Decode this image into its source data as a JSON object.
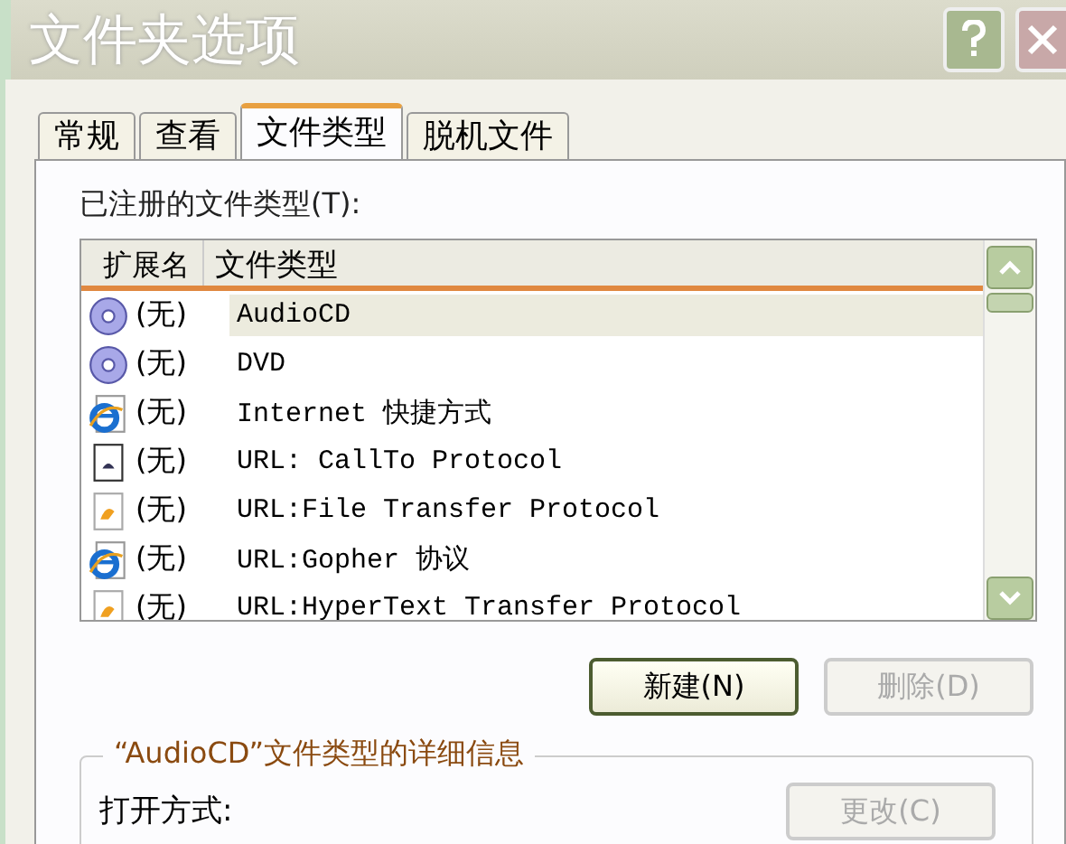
{
  "window": {
    "title": "文件夹选项"
  },
  "tabs": [
    {
      "label": "常规",
      "selected": false
    },
    {
      "label": "查看",
      "selected": false
    },
    {
      "label": "文件类型",
      "selected": true
    },
    {
      "label": "脱机文件",
      "selected": false
    }
  ],
  "list_label": "已注册的文件类型(T):",
  "table": {
    "columns": [
      "扩展名",
      "文件类型"
    ],
    "rows": [
      {
        "extension": "(无)",
        "type": "AudioCD",
        "kind": "disc",
        "selected": true
      },
      {
        "extension": "(无)",
        "type": "DVD",
        "kind": "disc",
        "selected": false
      },
      {
        "extension": "(无)",
        "type": "Internet 快捷方式",
        "kind": "browser",
        "selected": false
      },
      {
        "extension": "(无)",
        "type": "URL: CallTo Protocol",
        "kind": "document",
        "selected": false
      },
      {
        "extension": "(无)",
        "type": "URL:File Transfer Protocol",
        "kind": "folder-doc",
        "selected": false
      },
      {
        "extension": "(无)",
        "type": "URL:Gopher 协议",
        "kind": "browser",
        "selected": false
      },
      {
        "extension": "(无)",
        "type": "URL:HyperText Transfer Protocol",
        "kind": "folder-doc",
        "selected": false
      }
    ]
  },
  "buttons": [
    {
      "label": "新建(N)",
      "disabled": false
    },
    {
      "label": "删除(D)",
      "disabled": true
    }
  ],
  "details": {
    "title": "“AudioCD”文件类型的详细信息",
    "open_with_label": "打开方式:",
    "change_button": {
      "label": "更改(C)",
      "disabled": true
    }
  }
}
